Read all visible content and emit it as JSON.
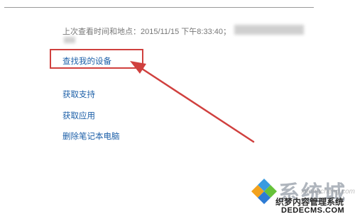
{
  "device": {
    "last_seen_label": "上次查看时间和地点：2015/11/15 下午8:33:40；"
  },
  "links": {
    "find_my_device": "查找我的设备",
    "get_support": "获取支持",
    "get_apps": "获取应用",
    "remove_laptop": "删除笔记本电脑"
  },
  "annotation": {
    "color": "#d0403e"
  },
  "watermark": {
    "brand": "系统城",
    "url_faint": "xitongcheng.com",
    "line1": "织梦内容管理系统",
    "line2": "DEDECMS.COM"
  }
}
